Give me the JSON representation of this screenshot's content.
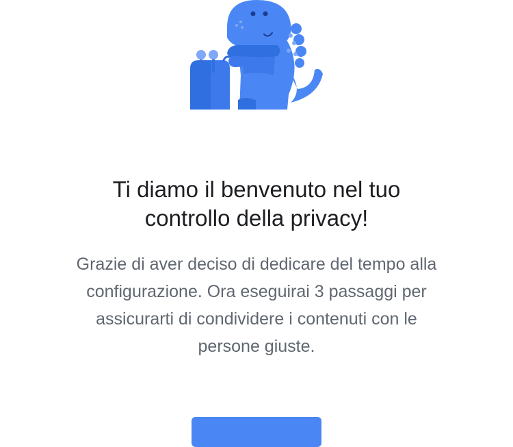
{
  "illustration": {
    "icon": "privacy-dinosaur-illustration",
    "colors": {
      "body": "#4a87f5",
      "dark": "#2f6fe0",
      "belly": "#3d79ea",
      "spots": "#7fa8f8",
      "eye": "#1b3d8f"
    }
  },
  "welcome": {
    "title_line_1": "Ti diamo il benvenuto nel tuo",
    "title_line_2": "controllo della privacy!",
    "description_line_1": "Grazie di aver deciso di dedicare del tempo alla",
    "description_line_2": "configurazione. Ora eseguirai 3 passaggi per",
    "description_line_3": "assicurarti di condividere i contenuti con le",
    "description_line_4": "persone giuste."
  },
  "primary_button": {
    "color": "#4a87f5"
  }
}
